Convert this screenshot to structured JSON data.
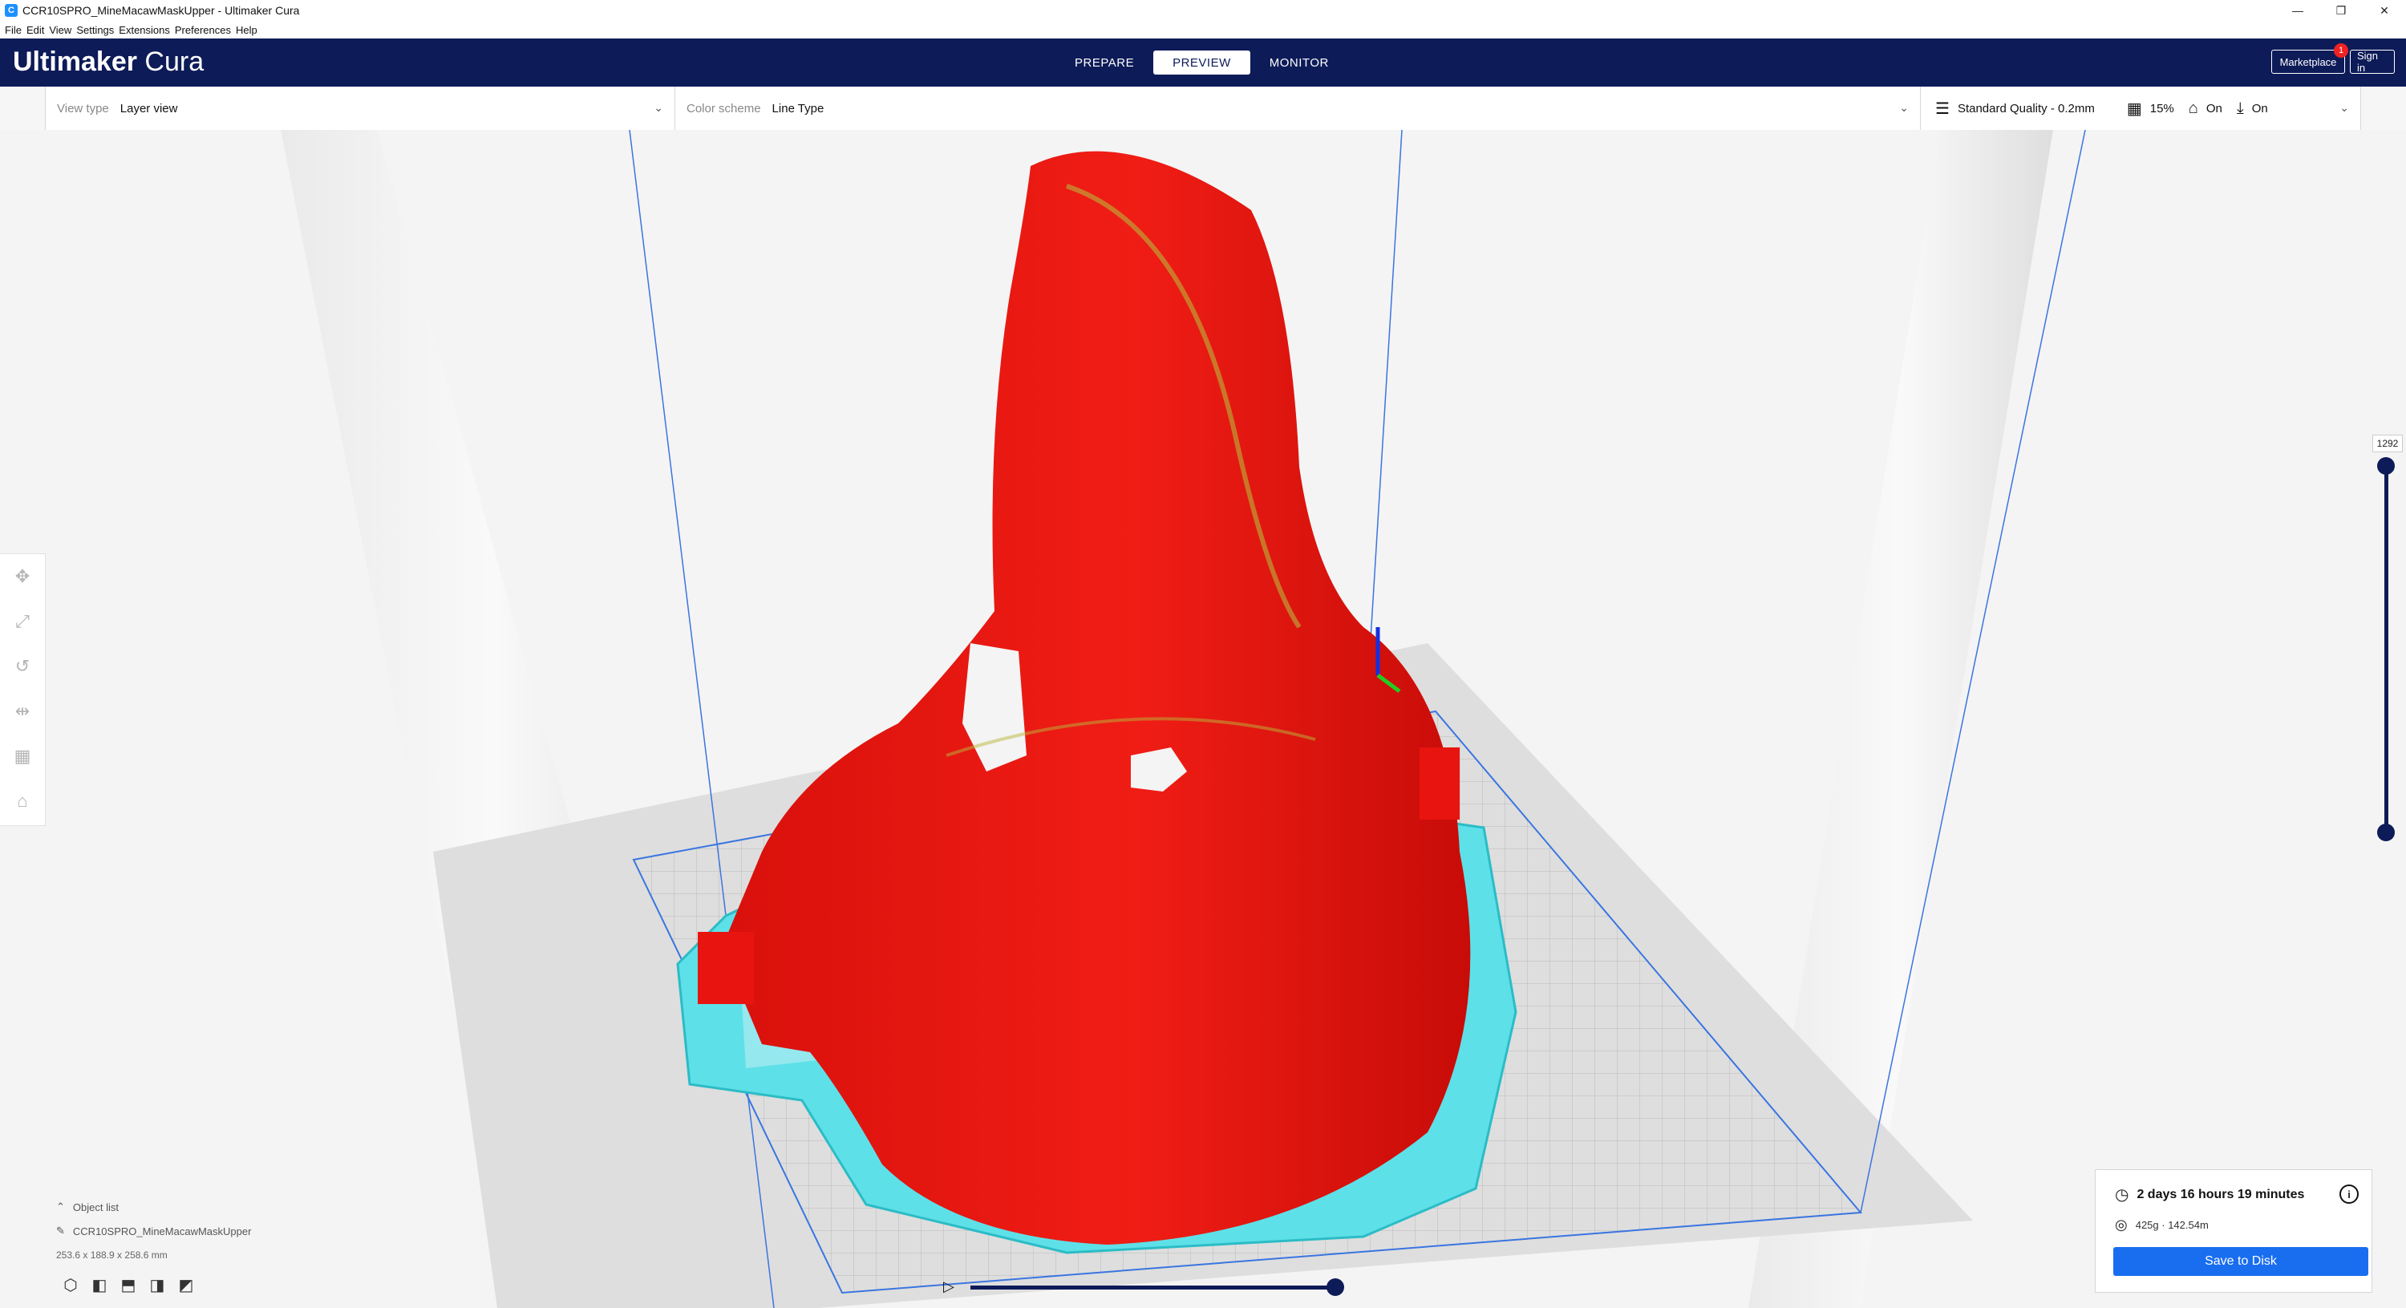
{
  "window": {
    "title": "CCR10SPRO_MineMacawMaskUpper - Ultimaker Cura",
    "icons": [
      "minimize-icon",
      "restore-icon",
      "close-icon"
    ]
  },
  "menu": [
    "File",
    "Edit",
    "View",
    "Settings",
    "Extensions",
    "Preferences",
    "Help"
  ],
  "header": {
    "brand_bold": "Ultimaker",
    "brand_light": "Cura",
    "stages": [
      "PREPARE",
      "PREVIEW",
      "MONITOR"
    ],
    "active_stage": "PREVIEW",
    "marketplace_label": "Marketplace",
    "marketplace_badge": "1",
    "signin_label": "Sign in"
  },
  "toolbar": {
    "view_type_label": "View type",
    "view_type_value": "Layer view",
    "color_scheme_label": "Color scheme",
    "color_scheme_value": "Line Type",
    "profile": "Standard Quality - 0.2mm",
    "infill": "15%",
    "support": "On",
    "adhesion": "On"
  },
  "layer_slider": {
    "current_layer": "1292"
  },
  "object_list": {
    "header": "Object list",
    "object_name": "CCR10SPRO_MineMacawMaskUpper",
    "dimensions": "253.6 x 188.9 x 258.6 mm"
  },
  "print_info": {
    "time": "2 days 16 hours 19 minutes",
    "material": "425g · 142.54m",
    "save_label": "Save to Disk"
  },
  "colors": {
    "header_bg": "#0d1b58",
    "accent": "#196ef0",
    "model_wall": "#e8140f",
    "support": "#5ee0e8"
  }
}
